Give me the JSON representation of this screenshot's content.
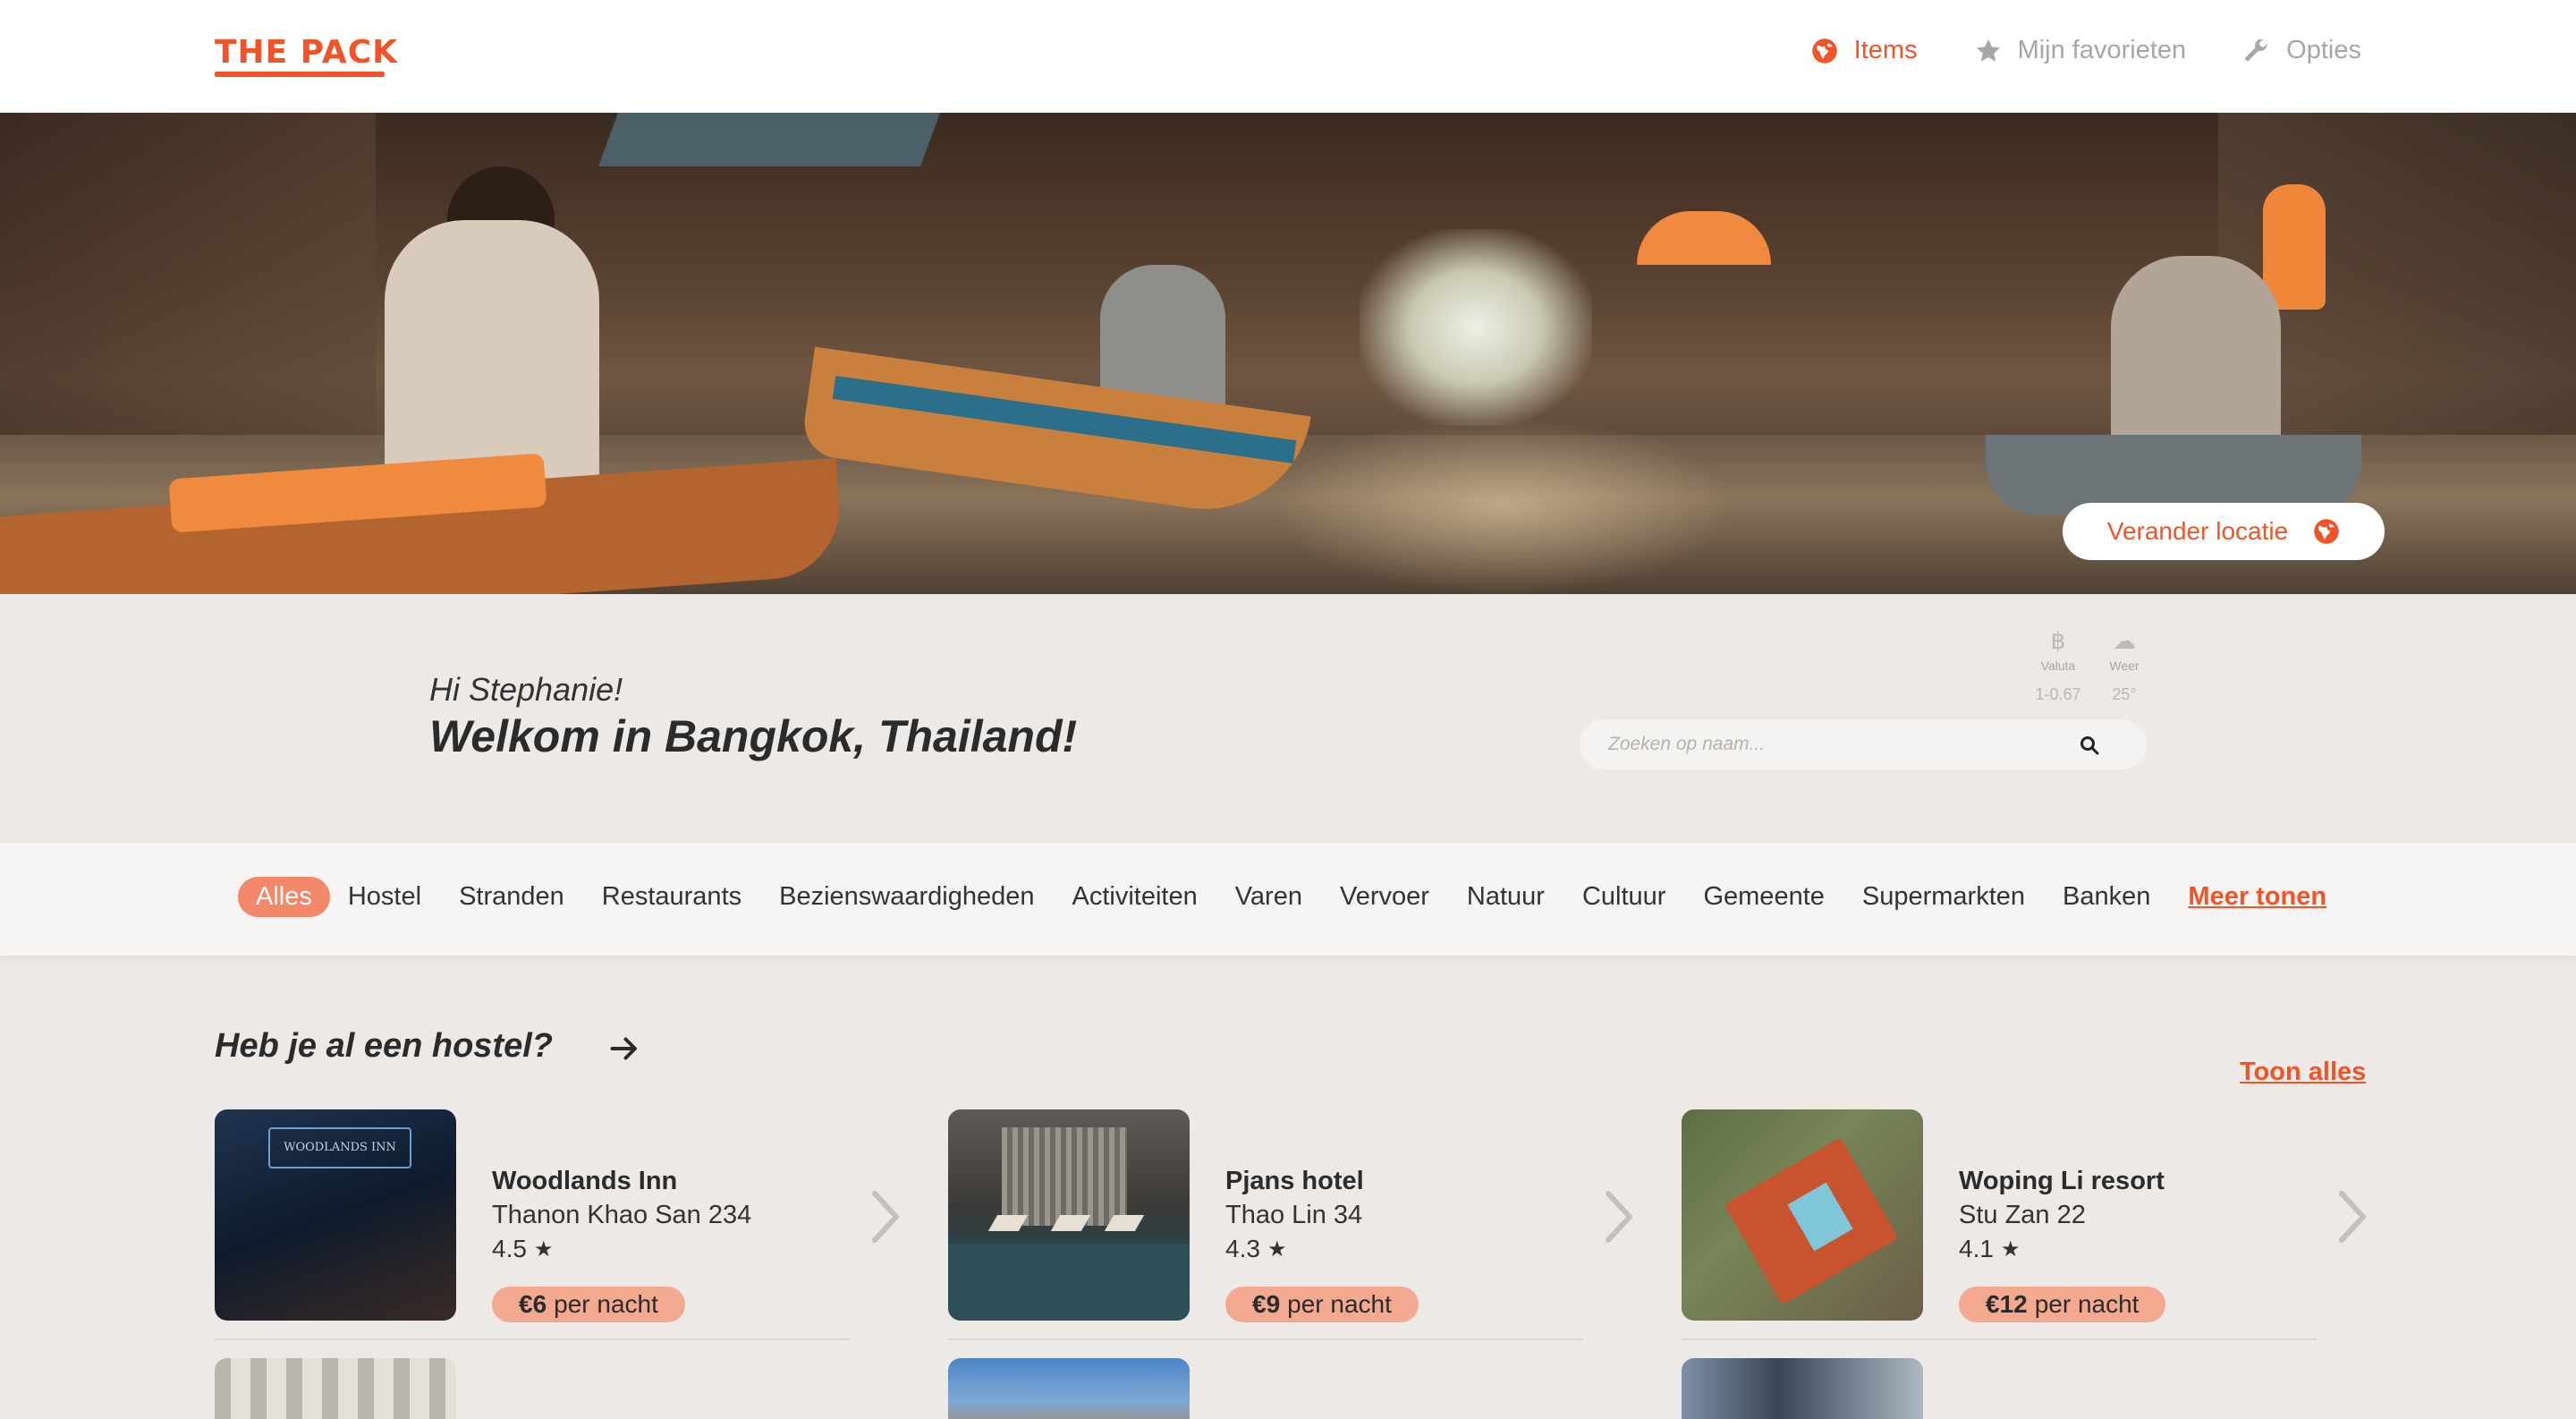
{
  "header": {
    "logo": "THE PACK",
    "nav": [
      {
        "label": "Items",
        "icon": "globe-icon",
        "active": true
      },
      {
        "label": "Mijn favorieten",
        "icon": "star-icon",
        "active": false
      },
      {
        "label": "Opties",
        "icon": "wrench-icon",
        "active": false
      }
    ]
  },
  "hero": {
    "change_location": "Verander locatie"
  },
  "welcome": {
    "greeting": "Hi Stephanie!",
    "title": "Welkom in Bangkok, Thailand!",
    "widgets": [
      {
        "icon": "baht-icon",
        "symbol": "฿",
        "label": "Valuta",
        "value": "1-0.67"
      },
      {
        "icon": "cloud-icon",
        "symbol": "☁",
        "label": "Weer",
        "value": "25°"
      }
    ],
    "search_placeholder": "Zoeken op naam..."
  },
  "categories": {
    "items": [
      "Alles",
      "Hostel",
      "Stranden",
      "Restaurants",
      "Bezienswaardigheden",
      "Activiteiten",
      "Varen",
      "Vervoer",
      "Natuur",
      "Cultuur",
      "Gemeente",
      "Supermarkten",
      "Banken"
    ],
    "active": "Alles",
    "more": "Meer tonen"
  },
  "section": {
    "title": "Heb je al een hostel?",
    "show_all": "Toon alles",
    "cards": [
      {
        "name": "Woodlands Inn",
        "address": "Thanon Khao San 234",
        "rating": "4.5",
        "price": "€6",
        "price_suffix": "per nacht",
        "thumb_sign": "WOODLANDS INN"
      },
      {
        "name": "Pjans hotel",
        "address": "Thao Lin 34",
        "rating": "4.3",
        "price": "€9",
        "price_suffix": "per nacht"
      },
      {
        "name": "Woping Li resort",
        "address": "Stu Zan 22",
        "rating": "4.1",
        "price": "€12",
        "price_suffix": "per nacht"
      }
    ]
  },
  "colors": {
    "accent": "#f0552a",
    "price_pill": "#f3a890",
    "active_category": "#f3876a",
    "background": "#ece9e6"
  }
}
